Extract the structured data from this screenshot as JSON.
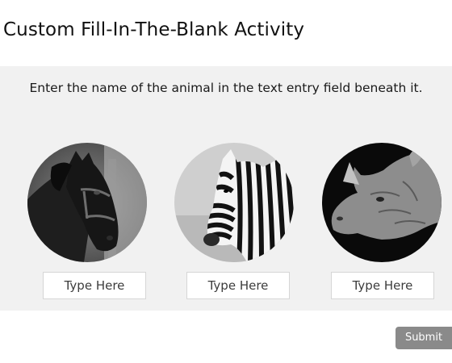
{
  "activity": {
    "title": "Custom Fill-In-The-Blank Activity",
    "instructions": "Enter the name of the animal in the text entry field beneath it."
  },
  "animals": [
    {
      "icon": "horse-photo",
      "input_placeholder": "Type Here",
      "input_value": ""
    },
    {
      "icon": "zebra-photo",
      "input_placeholder": "Type Here",
      "input_value": ""
    },
    {
      "icon": "rhino-photo",
      "input_placeholder": "Type Here",
      "input_value": ""
    }
  ],
  "actions": {
    "submit_label": "Submit"
  },
  "colors": {
    "panel_background": "#f1f1f1",
    "submit_background": "#8a8a8a",
    "field_border": "#d6d6d6"
  }
}
